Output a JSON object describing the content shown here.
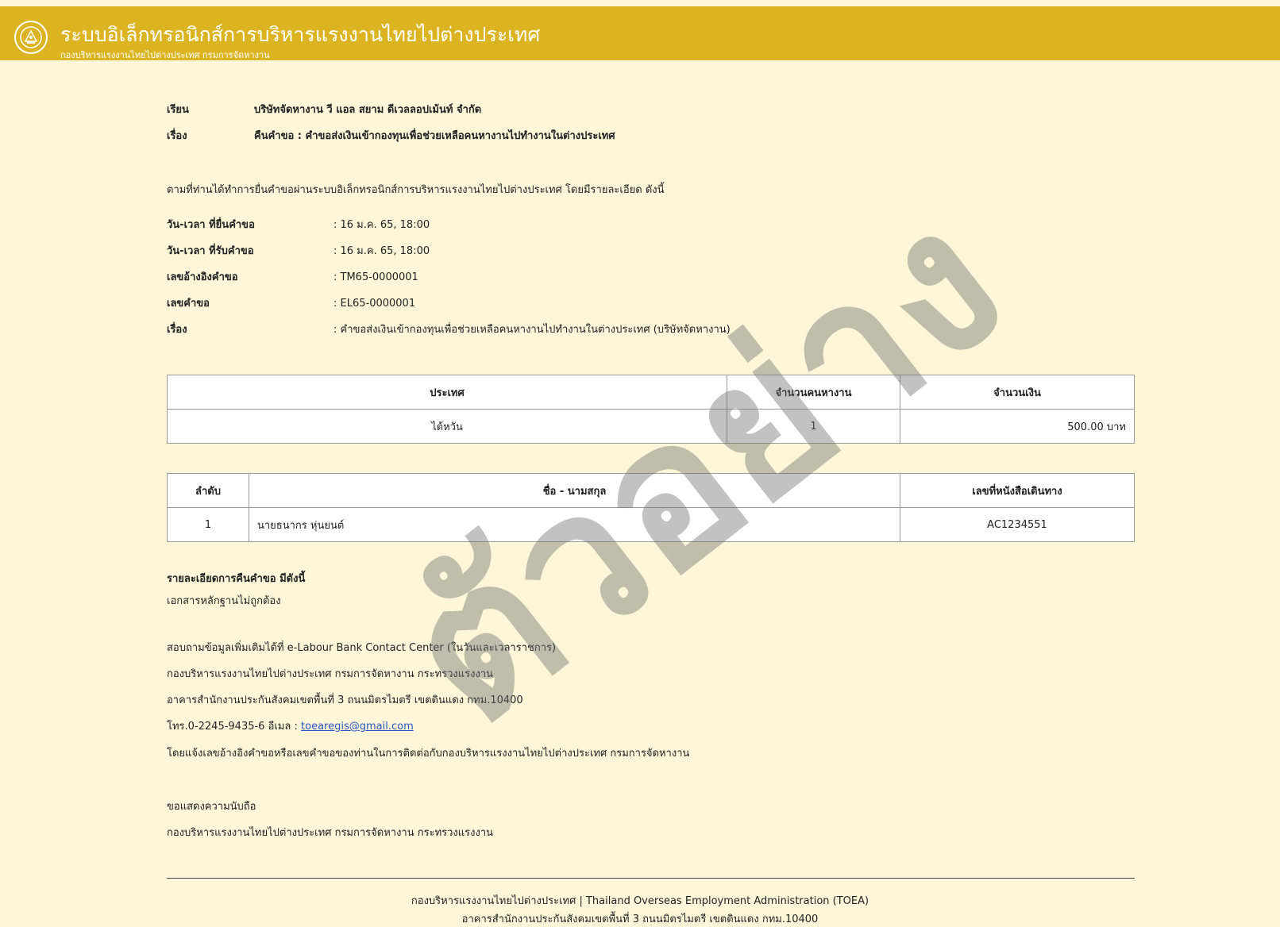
{
  "header": {
    "title": "ระบบอิเล็กทรอนิกส์การบริหารแรงงานไทยไปต่างประเทศ",
    "subtitle": "กองบริหารแรงงานไทยไปต่างประเทศ กรมการจัดหางาน"
  },
  "letter": {
    "to_label": "เรียน",
    "to_value": "บริษัทจัดหางาน วี แอล สยาม ดีเวลลอปเม้นท์ จำกัด",
    "subject_label": "เรื่อง",
    "subject_value": "คืนคำขอ : คำขอส่งเงินเข้ากองทุนเพื่อช่วยเหลือคนหางานไปทำงานในต่างประเทศ",
    "intro": "ตามที่ท่านได้ทำการยื่นคำขอผ่านระบบอิเล็กทรอนิกส์การบริหารแรงงานไทยไปต่างประเทศ โดยมีรายละเอียด ดังนี้"
  },
  "info": [
    {
      "label": "วัน-เวลา ที่ยื่นคำขอ",
      "value": ": 16 ม.ค. 65, 18:00"
    },
    {
      "label": "วัน-เวลา ที่รับคำขอ",
      "value": ": 16 ม.ค. 65, 18:00"
    },
    {
      "label": "เลขอ้างอิงคำขอ",
      "value": ": TM65-0000001"
    },
    {
      "label": "เลขคำขอ",
      "value": ": EL65-0000001"
    },
    {
      "label": "เรื่อง",
      "value": ": คำขอส่งเงินเข้ากองทุนเพื่อช่วยเหลือคนหางานไปทำงานในต่างประเทศ (บริษัทจัดหางาน)"
    }
  ],
  "country_table": {
    "headers": [
      "ประเทศ",
      "จำนวนคนหางาน",
      "จำนวนเงิน"
    ],
    "rows": [
      [
        "ไต้หวัน",
        "1",
        "500.00 บาท"
      ]
    ]
  },
  "worker_table": {
    "headers": [
      "ลำดับ",
      "ชื่อ - นามสกุล",
      "เลขที่หนังสือเดินทาง"
    ],
    "rows": [
      [
        "1",
        "นายธนากร หุ่นยนต์",
        "AC1234551"
      ]
    ]
  },
  "return_details": {
    "heading": "รายละเอียดการคืนคำขอ มีดังนี้",
    "text": "เอกสารหลักฐานไม่ถูกต้อง"
  },
  "contact": {
    "line1": "สอบถามข้อมูลเพิ่มเติมได้ที่ e-Labour Bank Contact Center (ในวันและเวลาราชการ)",
    "line2": "กองบริหารแรงงานไทยไปต่างประเทศ กรมการจัดหางาน กระทรวงแรงงาน",
    "line3": "อาคารสำนักงานประกันสังคมเขตพื้นที่ 3 ถนนมิตรไมตรี เขตดินแดง กทม.10400",
    "phone_prefix": "โทร.0-2245-9435-6 อีเมล : ",
    "email": "toearegis@gmail.com",
    "line5": "โดยแจ้งเลขอ้างอิงคำขอหรือเลขคำขอของท่านในการติดต่อกับกองบริหารแรงงานไทยไปต่างประเทศ กรมการจัดหางาน"
  },
  "closing": {
    "regards": "ขอแสดงความนับถือ",
    "signature": "กองบริหารแรงงานไทยไปต่างประเทศ กรมการจัดหางาน กระทรวงแรงงาน"
  },
  "footer": {
    "line1": "กองบริหารแรงงานไทยไปต่างประเทศ | Thailand Overseas Employment Administration (TOEA)",
    "line2": "อาคารสำนักงานประกันสังคมเขตพื้นที่ 3 ถนนมิตรไมตรี เขตดินแดง กทม.10400"
  },
  "watermark": "ตัวอย่าง",
  "colors": {
    "header_bg": "#dcb421",
    "page_bg": "#fdf6d8",
    "link": "#2a55c4"
  }
}
